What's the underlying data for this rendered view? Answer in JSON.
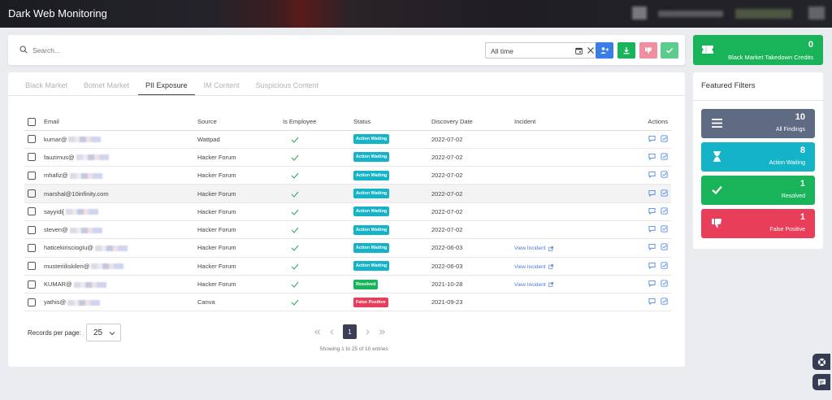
{
  "header": {
    "title": "Dark Web Monitoring"
  },
  "search": {
    "placeholder": "Search...",
    "date_range": "All time"
  },
  "credits": {
    "count": "0",
    "label": "Black Market Takedown Credits"
  },
  "tabs": [
    {
      "label": "Black Market",
      "active": false
    },
    {
      "label": "Botnet Market",
      "active": false
    },
    {
      "label": "PII Exposure",
      "active": true
    },
    {
      "label": "IM Content",
      "active": false
    },
    {
      "label": "Suspicious Content",
      "active": false
    }
  ],
  "table": {
    "columns": [
      "Email",
      "Source",
      "Is Employee",
      "Status",
      "Discovery Date",
      "Incident",
      "Actions"
    ],
    "rows": [
      {
        "email": "kumar@",
        "source": "Wattpad",
        "status": "Action Waiting",
        "status_type": "wait",
        "date": "2022-07-02",
        "incident": ""
      },
      {
        "email": "fauzimus@",
        "source": "Hacker Forum",
        "status": "Action Waiting",
        "status_type": "wait",
        "date": "2022-07-02",
        "incident": ""
      },
      {
        "email": "mhafiz@",
        "source": "Hacker Forum",
        "status": "Action Waiting",
        "status_type": "wait",
        "date": "2022-07-02",
        "incident": ""
      },
      {
        "email": "marshal@10infinity.com",
        "source": "Hacker Forum",
        "status": "Action Waiting",
        "status_type": "wait",
        "date": "2022-07-02",
        "incident": ""
      },
      {
        "email": "sayyidi[",
        "source": "Hacker Forum",
        "status": "Action Waiting",
        "status_type": "wait",
        "date": "2022-07-02",
        "incident": ""
      },
      {
        "email": "steven@",
        "source": "Hacker Forum",
        "status": "Action Waiting",
        "status_type": "wait",
        "date": "2022-07-02",
        "incident": ""
      },
      {
        "email": "haticekirisciogIu@",
        "source": "Hacker Forum",
        "status": "Action Waiting",
        "status_type": "wait",
        "date": "2022-06-03",
        "incident": "View Incident"
      },
      {
        "email": "musteriiliskileri@",
        "source": "Hacker Forum",
        "status": "Action Waiting",
        "status_type": "wait",
        "date": "2022-06-03",
        "incident": "View Incident"
      },
      {
        "email": "KUMAR@",
        "source": "Hacker Forum",
        "status": "Resolved",
        "status_type": "res",
        "date": "2021-10-28",
        "incident": "View Incident"
      },
      {
        "email": "yathis@",
        "source": "Canva",
        "status": "False Positive",
        "status_type": "fp",
        "date": "2021-09-23",
        "incident": ""
      }
    ]
  },
  "pagination": {
    "records_label": "Records per page:",
    "per_page": "25",
    "current_page": "1",
    "showing": "Showing 1 to 25 of 10 entries"
  },
  "featured": {
    "title": "Featured Filters",
    "tiles": [
      {
        "count": "10",
        "label": "All Findings",
        "color": "#5f6a83",
        "icon": "list-icon"
      },
      {
        "count": "8",
        "label": "Action Waiting",
        "color": "#14b3c8",
        "icon": "hourglass-icon"
      },
      {
        "count": "1",
        "label": "Resolved",
        "color": "#19b35a",
        "icon": "check-icon"
      },
      {
        "count": "1",
        "label": "False Positive",
        "color": "#e83e5a",
        "icon": "thumbs-down-icon"
      }
    ]
  },
  "colors": {
    "blue": "#3b7de6",
    "green": "#19b35a",
    "cyan": "#14b3c8",
    "red": "#e83e5a",
    "pink": "#f08fa0"
  }
}
